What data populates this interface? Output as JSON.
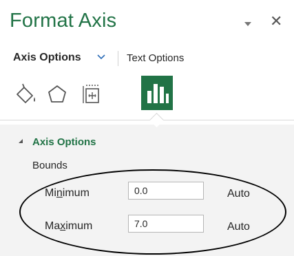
{
  "pane": {
    "title": "Format Axis",
    "close_glyph": "✕"
  },
  "tabs": {
    "axis_options": "Axis Options",
    "text_options": "Text Options"
  },
  "icons": [
    "fill-line-icon",
    "effects-icon",
    "size-properties-icon",
    "axis-options-icon"
  ],
  "section": {
    "title": "Axis Options",
    "group": "Bounds"
  },
  "bounds": {
    "minimum": {
      "label_pre": "Mi",
      "label_u": "n",
      "label_post": "imum",
      "value": "0.0",
      "auto": "Auto"
    },
    "maximum": {
      "label_pre": "Ma",
      "label_u": "x",
      "label_post": "imum",
      "value": "7.0",
      "auto": "Auto"
    }
  },
  "colors": {
    "accent": "#217346",
    "panel_bg": "#f3f3f3",
    "annotation": "#000000"
  }
}
